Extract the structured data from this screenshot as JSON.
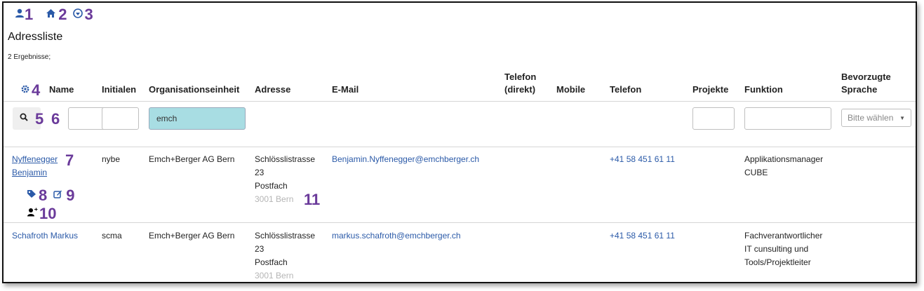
{
  "toolbar": {
    "icons": [
      {
        "icon": "user-icon",
        "marker": "1"
      },
      {
        "icon": "home-icon",
        "marker": "2"
      },
      {
        "icon": "circle-arrow-icon",
        "marker": "3"
      }
    ]
  },
  "page": {
    "title": "Adressliste",
    "results": "2 Ergebnisse;"
  },
  "table": {
    "settings_marker": "4",
    "columns": {
      "name": "Name",
      "initialen": "Initialen",
      "org": "Organisationseinheit",
      "adresse": "Adresse",
      "email": "E-Mail",
      "telefon_direkt_1": "Telefon",
      "telefon_direkt_2": "(direkt)",
      "mobile": "Mobile",
      "telefon": "Telefon",
      "projekte": "Projekte",
      "funktion": "Funktion",
      "sprache_1": "Bevorzugte",
      "sprache_2": "Sprache"
    },
    "filters": {
      "search_marker": "5",
      "name_marker": "6",
      "org_value": "emch",
      "sprache_placeholder": "Bitte wählen"
    },
    "rows": [
      {
        "name_line1": "Nyffenegger",
        "name_line2": "Benjamin",
        "name_marker": "7",
        "tag_marker": "8",
        "edit_marker": "9",
        "useradd_marker": "10",
        "address_marker": "11",
        "initialen": "nybe",
        "org": "Emch+Berger AG Bern",
        "adresse": [
          "Schlösslistrasse",
          "23",
          "Postfach",
          "3001 Bern"
        ],
        "email": "Benjamin.Nyffenegger@emchberger.ch",
        "telefon": "+41 58 451 61 11",
        "funktion": [
          "Applikationsmanager",
          "CUBE"
        ]
      },
      {
        "name_line1": "Schafroth Markus",
        "initialen": "scma",
        "org": "Emch+Berger AG Bern",
        "adresse": [
          "Schlösslistrasse",
          "23",
          "Postfach",
          "3001 Bern"
        ],
        "email": "markus.schafroth@emchberger.ch",
        "telefon": "+41 58 451 61 11",
        "funktion": [
          "Fachverantwortlicher",
          "IT cunsulting und",
          "Tools/Projektleiter"
        ]
      }
    ]
  },
  "colors": {
    "link": "#2b5aa8",
    "marker": "#6a3a9a",
    "highlight": "#a8dde3"
  }
}
